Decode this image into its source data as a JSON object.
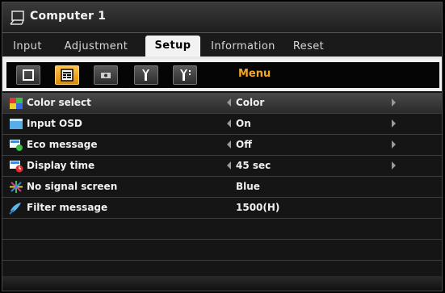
{
  "window": {
    "title": "Computer 1",
    "icon": "computer-input-icon"
  },
  "tabs": [
    {
      "label": "Input",
      "active": false
    },
    {
      "label": "Adjustment",
      "active": false
    },
    {
      "label": "Setup",
      "active": true
    },
    {
      "label": "Information",
      "active": false
    },
    {
      "label": "Reset",
      "active": false
    }
  ],
  "subbar": {
    "buttons": [
      {
        "name": "general-icon",
        "active": false
      },
      {
        "name": "menu-icon",
        "active": true
      },
      {
        "name": "installation-icon",
        "active": false
      },
      {
        "name": "control-icon",
        "active": false
      },
      {
        "name": "options-icon",
        "active": false
      }
    ],
    "label": "Menu"
  },
  "rows": [
    {
      "label": "Color select",
      "value": "Color",
      "icon": "color-select-icon",
      "arrows": true
    },
    {
      "label": "Input OSD",
      "value": "On",
      "icon": "input-osd-icon",
      "arrows": true
    },
    {
      "label": "Eco message",
      "value": "Off",
      "icon": "eco-message-icon",
      "arrows": true
    },
    {
      "label": "Display time",
      "value": "45 sec",
      "icon": "display-time-icon",
      "arrows": true
    },
    {
      "label": "No signal screen",
      "value": "Blue",
      "icon": "no-signal-screen-icon",
      "arrows": false
    },
    {
      "label": "Filter message",
      "value": "1500(H)",
      "icon": "filter-message-icon",
      "arrows": false
    }
  ],
  "colors": {
    "accent": "#f5a623",
    "active_tab_bg": "#f2f2f2",
    "active_button": "#f0a020"
  }
}
